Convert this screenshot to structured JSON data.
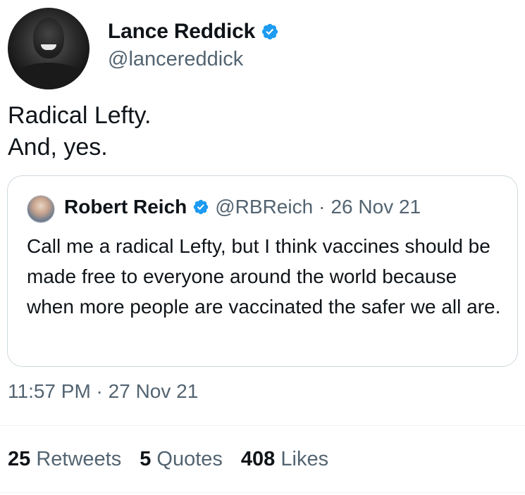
{
  "author": {
    "display_name": "Lance Reddick",
    "handle": "@lancereddick",
    "verified": true
  },
  "tweet": {
    "line1": "Radical Lefty.",
    "line2": "And, yes."
  },
  "quoted": {
    "display_name": "Robert Reich",
    "handle": "@RBReich",
    "separator": "·",
    "date": "26 Nov 21",
    "text": "Call me a radical Lefty, but I think vaccines should be made free to everyone around the world because when more people are vaccinated the safer we all are."
  },
  "timestamp": "11:57 PM · 27 Nov 21",
  "stats": {
    "retweets_count": "25",
    "retweets_label": "Retweets",
    "quotes_count": "5",
    "quotes_label": "Quotes",
    "likes_count": "408",
    "likes_label": "Likes"
  },
  "colors": {
    "verified_badge": "#1d9bf0",
    "secondary_text": "#536471",
    "border": "#cfd9de"
  },
  "icons": {
    "verified": "verified-badge-icon"
  }
}
